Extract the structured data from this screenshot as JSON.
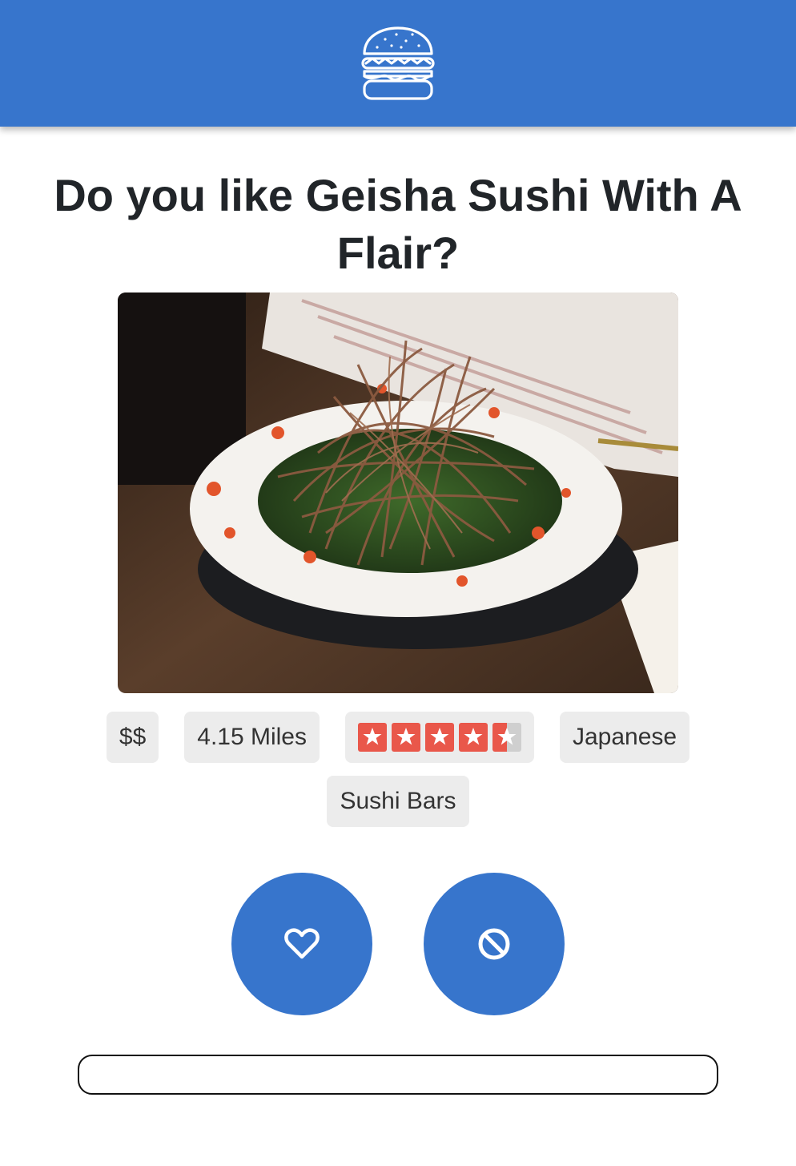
{
  "header": {
    "logo_icon": "burger-icon",
    "color": "#3775cc"
  },
  "question": {
    "prefix": "Do you like ",
    "restaurant_name": "Geisha Sushi With A Flair",
    "suffix": "?"
  },
  "tags": {
    "price": "$$",
    "distance": "4.15 Miles",
    "rating": 4.5,
    "rating_max": 5,
    "category_1": "Japanese",
    "category_2": "Sushi Bars"
  },
  "actions": {
    "like_icon": "heart-icon",
    "dislike_icon": "block-icon"
  },
  "bottom_input": {
    "value": ""
  }
}
